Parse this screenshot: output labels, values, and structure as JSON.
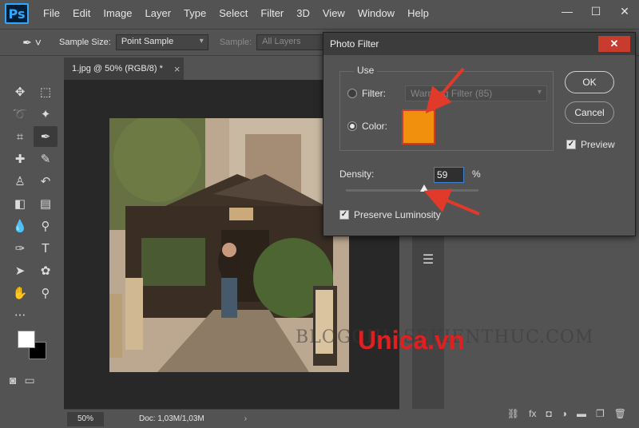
{
  "app": {
    "logo": "Ps"
  },
  "menu": [
    "File",
    "Edit",
    "Image",
    "Layer",
    "Type",
    "Select",
    "Filter",
    "3D",
    "View",
    "Window",
    "Help"
  ],
  "window_controls": {
    "minimize": "—",
    "maximize": "☐",
    "close": "✕"
  },
  "options_bar": {
    "sample_size_label": "Sample Size:",
    "sample_size_value": "Point Sample",
    "sample_label": "Sample:",
    "sample_value": "All Layers"
  },
  "document": {
    "tab_title": "1.jpg @ 50% (RGB/8) *",
    "tab_close": "×",
    "zoom": "50%",
    "doc_info": "Doc: 1,03M/1,03M",
    "status_arrow": "›"
  },
  "watermark": {
    "site": "BLOGCHIASEKIENTHUC.COM",
    "brand": "Unica.vn",
    "brand_color": "#e02020"
  },
  "dialog": {
    "title": "Photo Filter",
    "close": "✕",
    "use_legend": "Use",
    "filter_label": "Filter:",
    "filter_value": "Warming Filter (85)",
    "color_label": "Color:",
    "selected_use": "Color",
    "color_swatch": "#f0900c",
    "density_label": "Density:",
    "density_value": "59",
    "density_unit": "%",
    "density_percent": 59,
    "preserve_luminosity_label": "Preserve Luminosity",
    "preserve_luminosity_checked": true,
    "ok_label": "OK",
    "cancel_label": "Cancel",
    "preview_label": "Preview",
    "preview_checked": true
  },
  "tools": [
    "move-icon",
    "marquee-icon",
    "lasso-icon",
    "magic-wand-icon",
    "crop-icon",
    "eyedropper-icon",
    "healing-icon",
    "brush-icon",
    "stamp-icon",
    "history-brush-icon",
    "eraser-icon",
    "gradient-icon",
    "blur-icon",
    "dodge-icon",
    "pen-icon",
    "type-icon",
    "path-select-icon",
    "shape-icon",
    "hand-icon",
    "zoom-icon"
  ],
  "colors": {
    "foreground": "#ffffff",
    "background": "#000000",
    "annotation_arrow": "#e23a2a"
  }
}
